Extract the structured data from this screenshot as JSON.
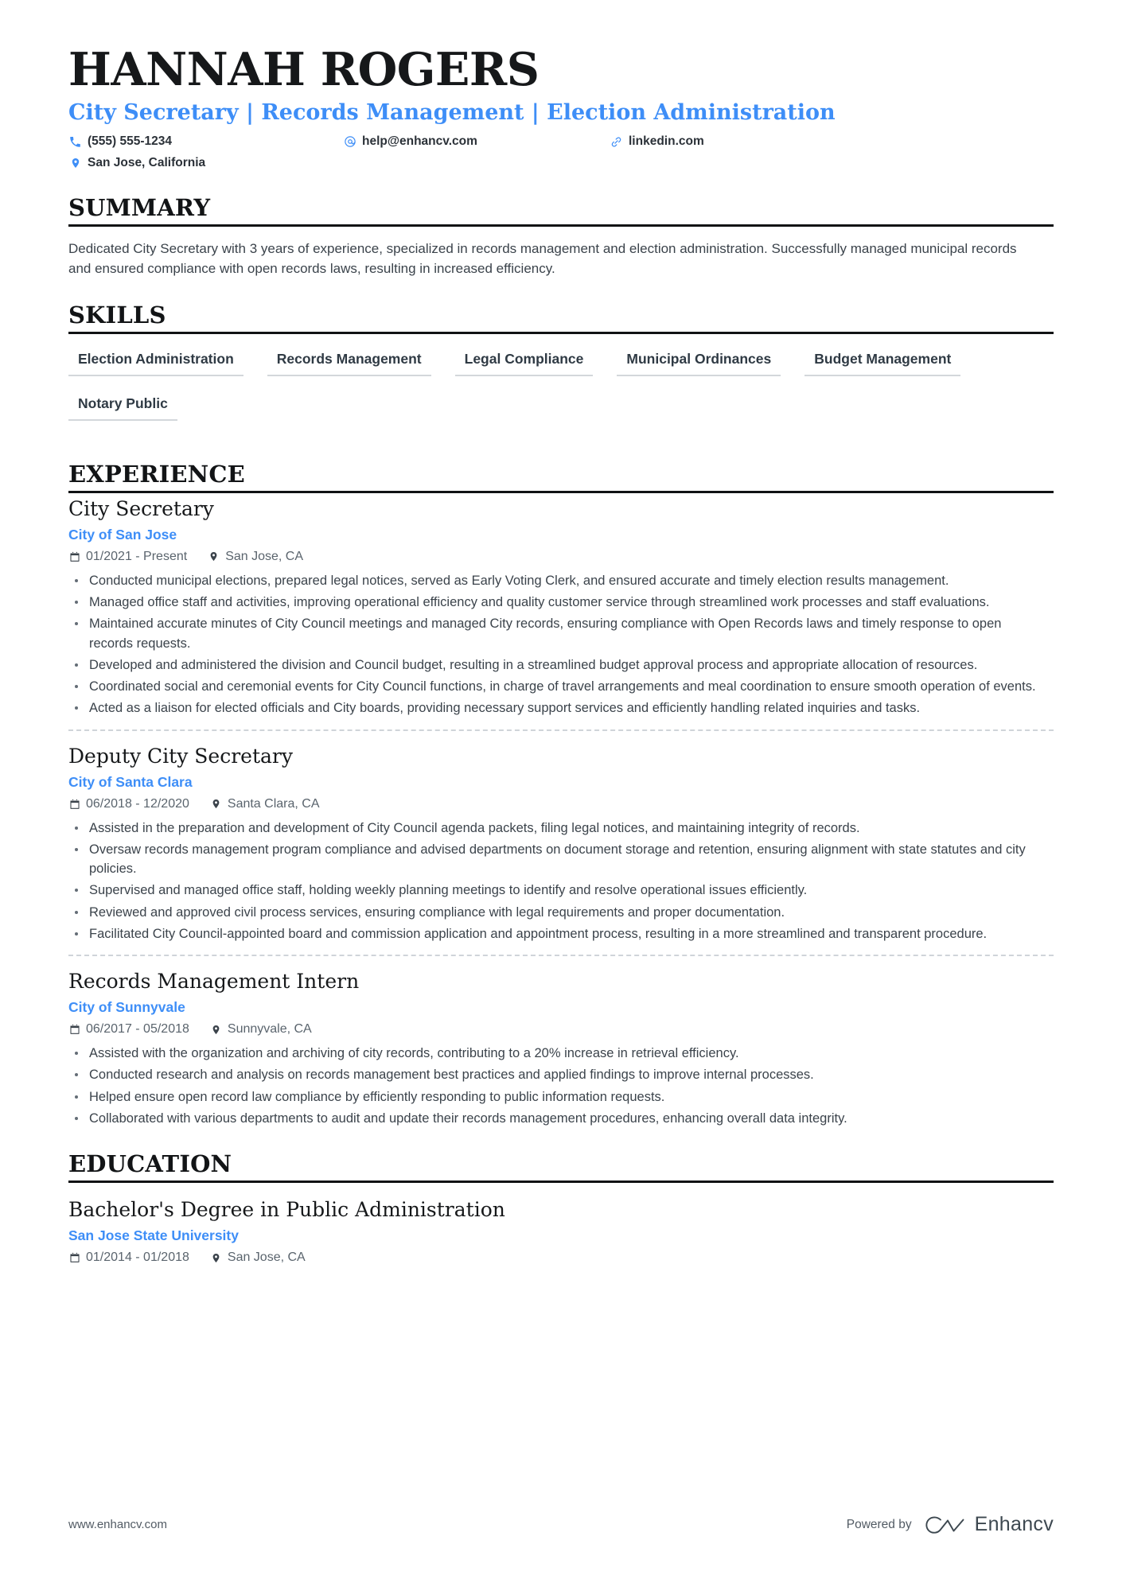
{
  "header": {
    "name": "HANNAH ROGERS",
    "headline": "City Secretary | Records Management | Election Administration",
    "contacts": [
      {
        "icon": "phone-icon",
        "text": "(555) 555-1234"
      },
      {
        "icon": "email-icon",
        "text": "help@enhancv.com"
      },
      {
        "icon": "link-icon",
        "text": "linkedin.com"
      },
      {
        "icon": "location-icon",
        "text": "San Jose, California"
      }
    ]
  },
  "summary": {
    "title": "SUMMARY",
    "text": "Dedicated City Secretary with 3 years of experience, specialized in records management and election administration. Successfully managed municipal records and ensured compliance with open records laws, resulting in increased efficiency."
  },
  "skills": {
    "title": "SKILLS",
    "items": [
      "Election Administration",
      "Records Management",
      "Legal Compliance",
      "Municipal Ordinances",
      "Budget Management",
      "Notary Public"
    ]
  },
  "experience": {
    "title": "EXPERIENCE",
    "entries": [
      {
        "role": "City Secretary",
        "org": "City of San Jose",
        "dates": "01/2021 - Present",
        "location": "San Jose, CA",
        "bullets": [
          "Conducted municipal elections, prepared legal notices, served as Early Voting Clerk, and ensured accurate and timely election results management.",
          "Managed office staff and activities, improving operational efficiency and quality customer service through streamlined work processes and staff evaluations.",
          "Maintained accurate minutes of City Council meetings and managed City records, ensuring compliance with Open Records laws and timely response to open records requests.",
          "Developed and administered the division and Council budget, resulting in a streamlined budget approval process and appropriate allocation of resources.",
          "Coordinated social and ceremonial events for City Council functions, in charge of travel arrangements and meal coordination to ensure smooth operation of events.",
          "Acted as a liaison for elected officials and City boards, providing necessary support services and efficiently handling related inquiries and tasks."
        ]
      },
      {
        "role": "Deputy City Secretary",
        "org": "City of Santa Clara",
        "dates": "06/2018 - 12/2020",
        "location": "Santa Clara, CA",
        "bullets": [
          "Assisted in the preparation and development of City Council agenda packets, filing legal notices, and maintaining integrity of records.",
          "Oversaw records management program compliance and advised departments on document storage and retention, ensuring alignment with state statutes and city policies.",
          "Supervised and managed office staff, holding weekly planning meetings to identify and resolve operational issues efficiently.",
          "Reviewed and approved civil process services, ensuring compliance with legal requirements and proper documentation.",
          "Facilitated City Council-appointed board and commission application and appointment process, resulting in a more streamlined and transparent procedure."
        ]
      },
      {
        "role": "Records Management Intern",
        "org": "City of Sunnyvale",
        "dates": "06/2017 - 05/2018",
        "location": "Sunnyvale, CA",
        "bullets": [
          "Assisted with the organization and archiving of city records, contributing to a 20% increase in retrieval efficiency.",
          "Conducted research and analysis on records management best practices and applied findings to improve internal processes.",
          "Helped ensure open record law compliance by efficiently responding to public information requests.",
          "Collaborated with various departments to audit and update their records management procedures, enhancing overall data integrity."
        ]
      }
    ]
  },
  "education": {
    "title": "EDUCATION",
    "entries": [
      {
        "degree": "Bachelor's Degree in Public Administration",
        "school": "San Jose State University",
        "dates": "01/2014 - 01/2018",
        "location": "San Jose, CA"
      }
    ]
  },
  "footer": {
    "url": "www.enhancv.com",
    "powered_by": "Powered by",
    "brand": "Enhancv"
  },
  "colors": {
    "accent_blue": "#3e8ef7",
    "text_dark": "#16181a",
    "text_body": "#3b434b",
    "rule_black": "#101214",
    "skill_underline": "#d3d7db"
  }
}
